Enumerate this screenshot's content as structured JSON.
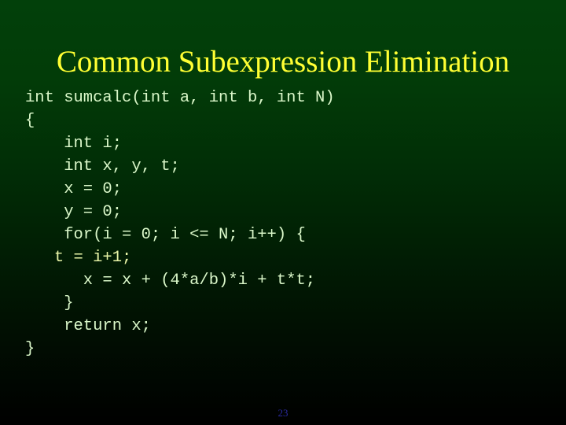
{
  "slide": {
    "title": "Common Subexpression Elimination",
    "page_number": "23",
    "colors": {
      "background_top": "#02400a",
      "background_bottom": "#000000",
      "title_color": "#ffff33",
      "code_color": "#daf7c9",
      "code_accent_color": "#e9f5a8",
      "page_number_color": "#2a2a9e"
    }
  },
  "code": {
    "language": "c",
    "lines": [
      {
        "text": "int sumcalc(int a, int b, int N)",
        "accent": false
      },
      {
        "text": "{",
        "accent": false
      },
      {
        "text": "    int i;",
        "accent": false
      },
      {
        "text": "    int x, y, t;",
        "accent": false
      },
      {
        "text": "    x = 0;",
        "accent": false
      },
      {
        "text": "    y = 0;",
        "accent": false
      },
      {
        "text": "    for(i = 0; i <= N; i++) {",
        "accent": false
      },
      {
        "text": "   t = i+1;",
        "accent": true
      },
      {
        "text": "      x = x + (4*a/b)*i + t*t;",
        "accent": false
      },
      {
        "text": "    }",
        "accent": false
      },
      {
        "text": "    return x;",
        "accent": false
      },
      {
        "text": "}",
        "accent": false
      }
    ]
  }
}
